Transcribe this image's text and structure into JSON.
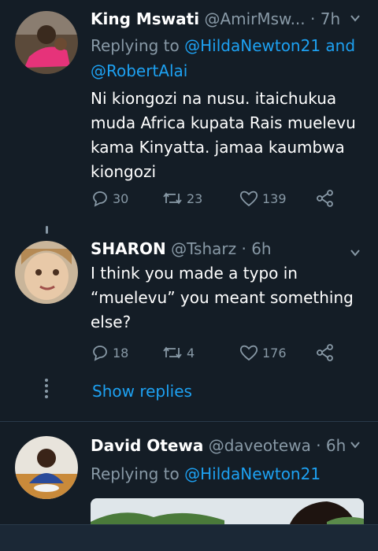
{
  "tweets": [
    {
      "name": "King Mswati",
      "handle": "@AmirMsw...",
      "dot": "·",
      "time": "7h",
      "replying_prefix": "Replying to ",
      "replying_to_1": "@HildaNewton21",
      "replying_and": " and",
      "replying_to_2": "@RobertAlai",
      "text": "Ni kiongozi na nusu. itaichukua muda Africa kupata Rais muelevu kama Kinyatta. jamaa kaumbwa kiongozi",
      "replies": "30",
      "retweets": "23",
      "likes": "139"
    },
    {
      "name": "SHARON",
      "handle": "@Tsharz",
      "dot": "·",
      "time": "6h",
      "text": "I think you made a typo in “muelevu” you meant something else?",
      "replies": "18",
      "retweets": "4",
      "likes": "176"
    },
    {
      "name": "David Otewa",
      "handle": "@daveotewa",
      "dot": "·",
      "time": "6h",
      "replying_prefix": "Replying to ",
      "replying_to_1": "@HildaNewton21"
    }
  ],
  "show_replies": "Show replies",
  "colors": {
    "background": "#141d26",
    "accent": "#1da1f2",
    "muted": "#8899a6",
    "text": "#ffffff"
  },
  "icons": [
    "reply-icon",
    "retweet-icon",
    "like-icon",
    "share-icon",
    "chevron-down-icon",
    "more-dots-icon"
  ]
}
